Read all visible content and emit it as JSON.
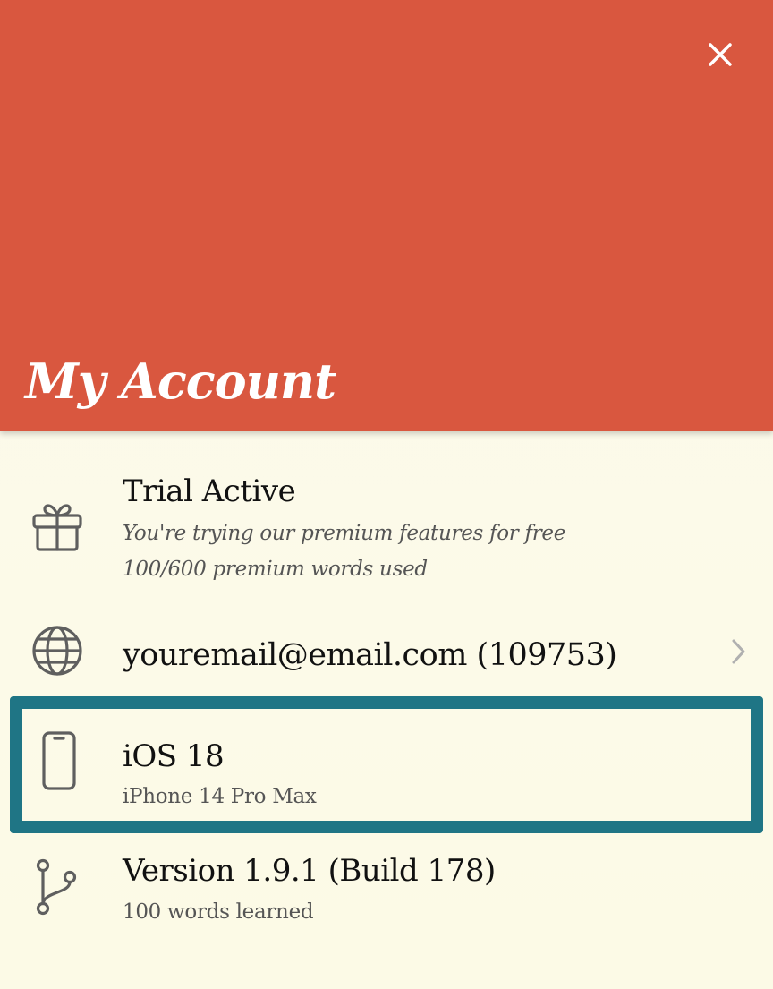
{
  "header": {
    "title": "My Account",
    "background_color": "#d9573f",
    "close_icon": "close-icon"
  },
  "rows": {
    "trial": {
      "icon": "gift-icon",
      "title": "Trial Active",
      "subtitle": "You're trying our premium features for free",
      "usage": "100/600 premium words used"
    },
    "account": {
      "icon": "globe-icon",
      "title": "youremail@email.com (109753)",
      "trailing_icon": "chevron-right-icon"
    },
    "device": {
      "icon": "phone-icon",
      "title": "iOS 18",
      "subtitle": "iPhone 14 Pro Max",
      "highlight_color": "#1f7585"
    },
    "version": {
      "icon": "branch-icon",
      "title": "Version 1.9.1 (Build 178)",
      "subtitle": "100 words learned"
    }
  }
}
